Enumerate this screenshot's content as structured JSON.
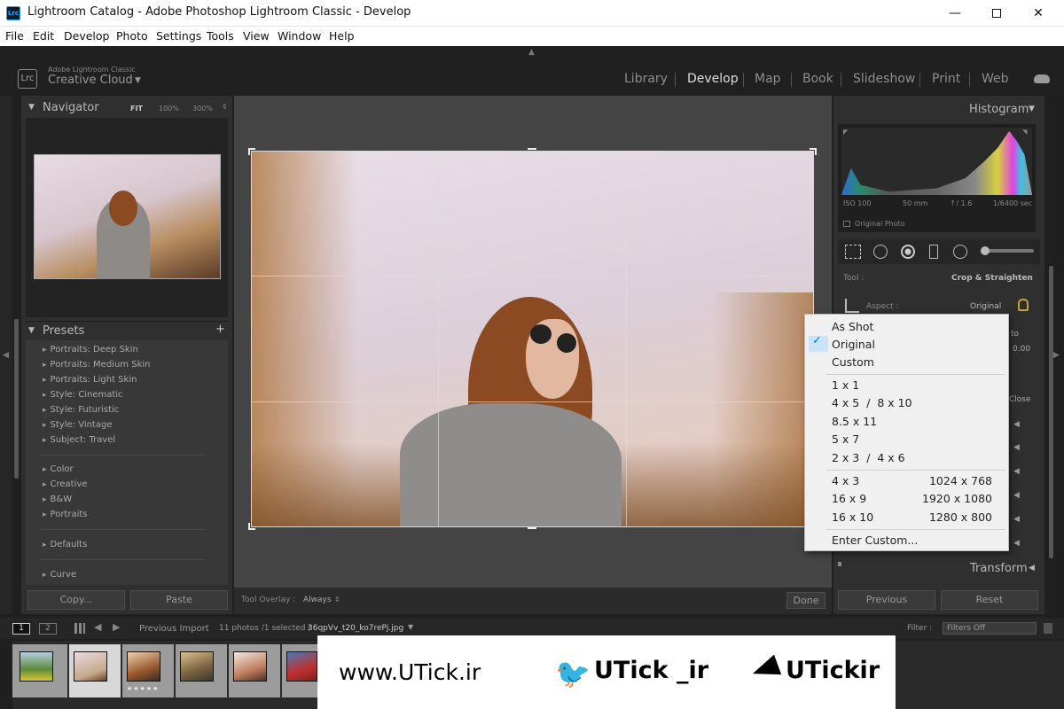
{
  "window": {
    "title": "Lightroom Catalog - Adobe Photoshop Lightroom Classic - Develop",
    "app_icon": "Lrc"
  },
  "menubar": [
    "File",
    "Edit",
    "Develop",
    "Photo",
    "Settings",
    "Tools",
    "View",
    "Window",
    "Help"
  ],
  "identity": {
    "logo": "Lrc",
    "line1": "Adobe Lightroom Classic",
    "line2": "Creative Cloud"
  },
  "modules": [
    "Library",
    "Develop",
    "Map",
    "Book",
    "Slideshow",
    "Print",
    "Web"
  ],
  "navigator": {
    "title": "Navigator",
    "fit": "FIT",
    "z1": "100%",
    "z2": "300%"
  },
  "presets": {
    "title": "Presets",
    "items": [
      "Portraits: Deep Skin",
      "Portraits: Medium Skin",
      "Portraits: Light Skin",
      "Style: Cinematic",
      "Style: Futuristic",
      "Style: Vintage",
      "Subject: Travel"
    ],
    "groups": [
      "Color",
      "Creative",
      "B&W",
      "Portraits"
    ],
    "defaults": "Defaults",
    "curve": "Curve"
  },
  "left_buttons": {
    "copy": "Copy...",
    "paste": "Paste"
  },
  "toolbar": {
    "overlay_label": "Tool Overlay :",
    "overlay_value": "Always",
    "done": "Done"
  },
  "histogram": {
    "title": "Histogram",
    "iso": "ISO 100",
    "focal": "50 mm",
    "fstop": "f / 1.6",
    "shutter": "1/6400 sec",
    "original": "Original Photo"
  },
  "crop": {
    "tool_label": "Tool :",
    "tool_value": "Crop & Straighten",
    "aspect_label": "Aspect :",
    "aspect_value": "Original",
    "partial_to": "to",
    "partial_val": "0.00",
    "partial_close": "Close"
  },
  "right_sections": {
    "transform": "Transform"
  },
  "right_buttons": {
    "previous": "Previous",
    "reset": "Reset"
  },
  "aspect_menu": {
    "group1": [
      "As Shot",
      "Original",
      "Custom"
    ],
    "group2": [
      "1 x 1",
      "4 x 5  /  8 x 10",
      "8.5 x 11",
      "5 x 7",
      "2 x 3  /  4 x 6"
    ],
    "group3": [
      {
        "ratio": "4 x 3",
        "res": "1024 x 768"
      },
      {
        "ratio": "16 x 9",
        "res": "1920 x 1080"
      },
      {
        "ratio": "16 x 10",
        "res": "1280 x 800"
      }
    ],
    "enter_custom": "Enter Custom...",
    "checked": "Original"
  },
  "filmstrip": {
    "page1": "1",
    "page2": "2",
    "source": "Previous Import",
    "count": "11 photos /1 selected /",
    "filename": "36qpVv_t20_ko7rePj.jpg",
    "filter_label": "Filter :",
    "filter_value": "Filters Off",
    "stars": "★★★★★"
  },
  "banner": {
    "site": "www.UTick.ir",
    "twitter": "UTick _ir",
    "telegram": "UTickir"
  },
  "colors": {
    "accent": "#31a8ff",
    "check": "#0078d7"
  }
}
